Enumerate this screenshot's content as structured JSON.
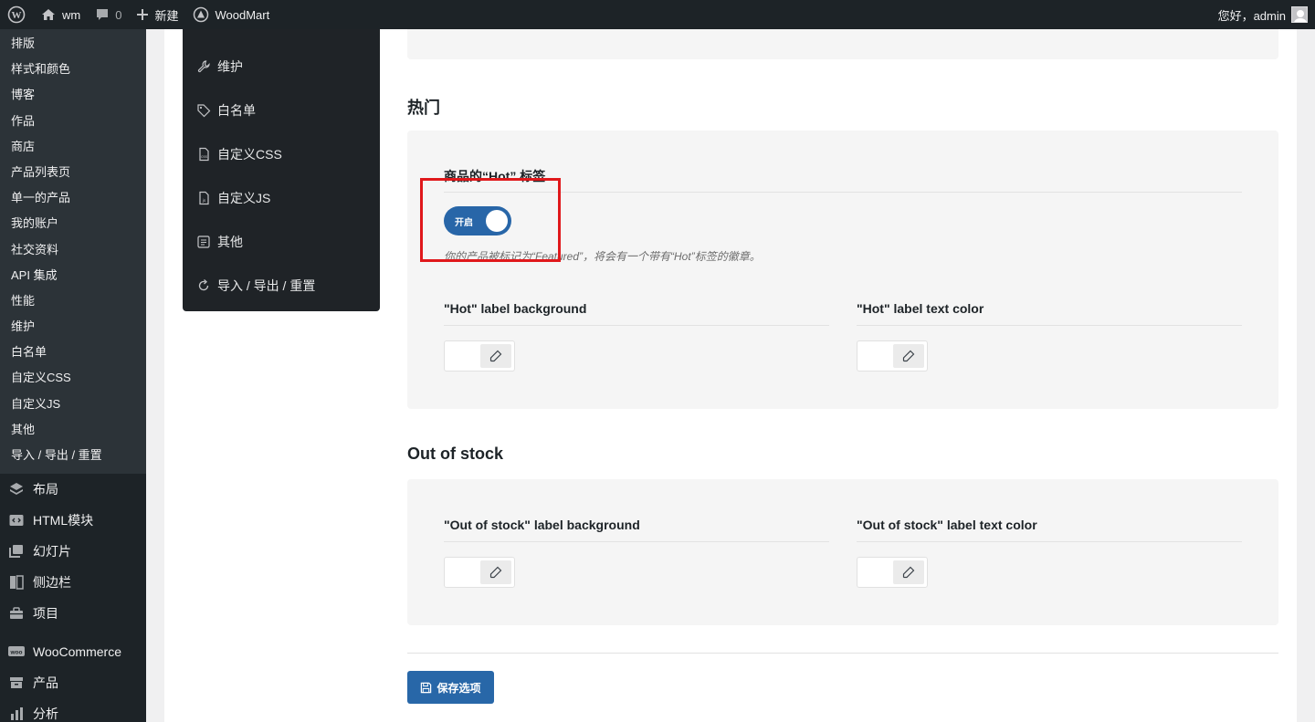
{
  "adminbar": {
    "site_name": "wm",
    "comments_count": "0",
    "new_label": "新建",
    "plugin_label": "WoodMart",
    "greeting": "您好，admin"
  },
  "sidebar": {
    "submenu": [
      "排版",
      "样式和颜色",
      "博客",
      "作品",
      "商店",
      "产品列表页",
      "单一的产品",
      "我的账户",
      "社交资料",
      "API 集成",
      "性能",
      "维护",
      "白名单",
      "自定义CSS",
      "自定义JS",
      "其他",
      "导入 / 导出 / 重置"
    ],
    "menu": [
      {
        "label": "布局",
        "icon": "layers-icon"
      },
      {
        "label": "HTML模块",
        "icon": "code-block-icon"
      },
      {
        "label": "幻灯片",
        "icon": "slides-icon"
      },
      {
        "label": "侧边栏",
        "icon": "sidebar-icon"
      },
      {
        "label": "项目",
        "icon": "briefcase-icon"
      },
      {
        "label": "WooCommerce",
        "icon": "woocommerce-icon"
      },
      {
        "label": "产品",
        "icon": "archive-icon"
      },
      {
        "label": "分析",
        "icon": "chart-icon"
      }
    ]
  },
  "options_nav": [
    {
      "label": "维护",
      "icon": "wrench-icon"
    },
    {
      "label": "白名单",
      "icon": "tag-icon"
    },
    {
      "label": "自定义CSS",
      "icon": "css-file-icon"
    },
    {
      "label": "自定义JS",
      "icon": "js-file-icon"
    },
    {
      "label": "其他",
      "icon": "misc-icon"
    },
    {
      "label": "导入 / 导出 / 重置",
      "icon": "reset-icon"
    }
  ],
  "hot_section": {
    "title": "热门",
    "hot_label": {
      "title": "商品的“Hot” 标签",
      "toggle_text": "开启",
      "enabled": true,
      "description": "你的产品被标记为“Featured”，将会有一个带有“Hot”标签的徽章。"
    },
    "bg_title": "\"Hot\" label background",
    "text_color_title": "\"Hot\" label text color"
  },
  "out_of_stock_section": {
    "title": "Out of stock",
    "bg_title": "\"Out of stock\" label background",
    "text_color_title": "\"Out of stock\" label text color"
  },
  "save_label": "保存选项",
  "colors": {
    "accent": "#2866a8",
    "highlight": "#e0181b",
    "admin_dark": "#1d2327"
  }
}
